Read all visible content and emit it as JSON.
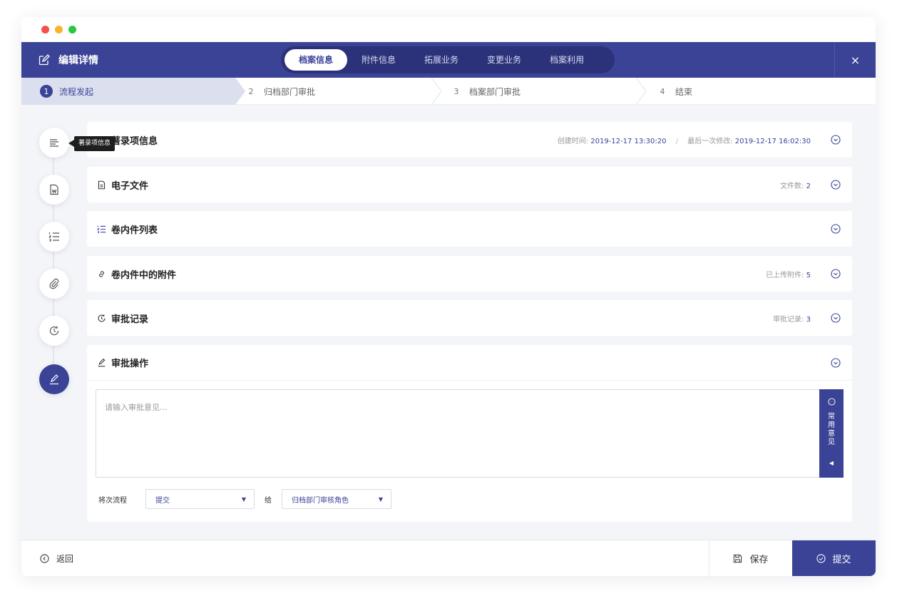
{
  "header": {
    "title": "编辑详情",
    "tabs": [
      {
        "label": "档案信息"
      },
      {
        "label": "附件信息"
      },
      {
        "label": "拓展业务"
      },
      {
        "label": "变更业务"
      },
      {
        "label": "档案利用"
      }
    ],
    "close_label": "×"
  },
  "steps": [
    {
      "num": "1",
      "label": "流程发起"
    },
    {
      "num": "2",
      "label": "归档部门审批"
    },
    {
      "num": "3",
      "label": "档案部门审批"
    },
    {
      "num": "4",
      "label": "结束"
    }
  ],
  "rail": {
    "tooltip": "著录项信息",
    "items": [
      "lines-icon",
      "word-doc-icon",
      "list-icon",
      "paperclip-icon",
      "history-icon",
      "pen-icon"
    ]
  },
  "sections": {
    "catalog": {
      "title": "著录项信息",
      "created_label": "创建时间:",
      "created_value": "2019-12-17 13:30:20",
      "separator": "/",
      "modified_label": "最后一次修改:",
      "modified_value": "2019-12-17 16:02:30"
    },
    "efile": {
      "title": "电子文件",
      "meta_label": "文件数:",
      "meta_value": "2"
    },
    "volume_list": {
      "title": "卷内件列表"
    },
    "attachments": {
      "title": "卷内件中的附件",
      "meta_label": "已上传附件:",
      "meta_value": "5"
    },
    "approval_records": {
      "title": "审批记录",
      "meta_label": "审批记录:",
      "meta_value": "3"
    },
    "approval_op": {
      "title": "审批操作",
      "placeholder": "请输入审批意见...",
      "common_opinions": [
        "常",
        "用",
        "意",
        "见"
      ],
      "flow_label": "将次流程",
      "flow_value": "提交",
      "to_label": "给",
      "role_value": "归档部门审核角色"
    }
  },
  "footer": {
    "back_label": "返回",
    "save_label": "保存",
    "submit_label": "提交"
  },
  "colors": {
    "primary": "#3b4396",
    "tab_track": "#2c3279",
    "background": "#f4f5f8"
  }
}
